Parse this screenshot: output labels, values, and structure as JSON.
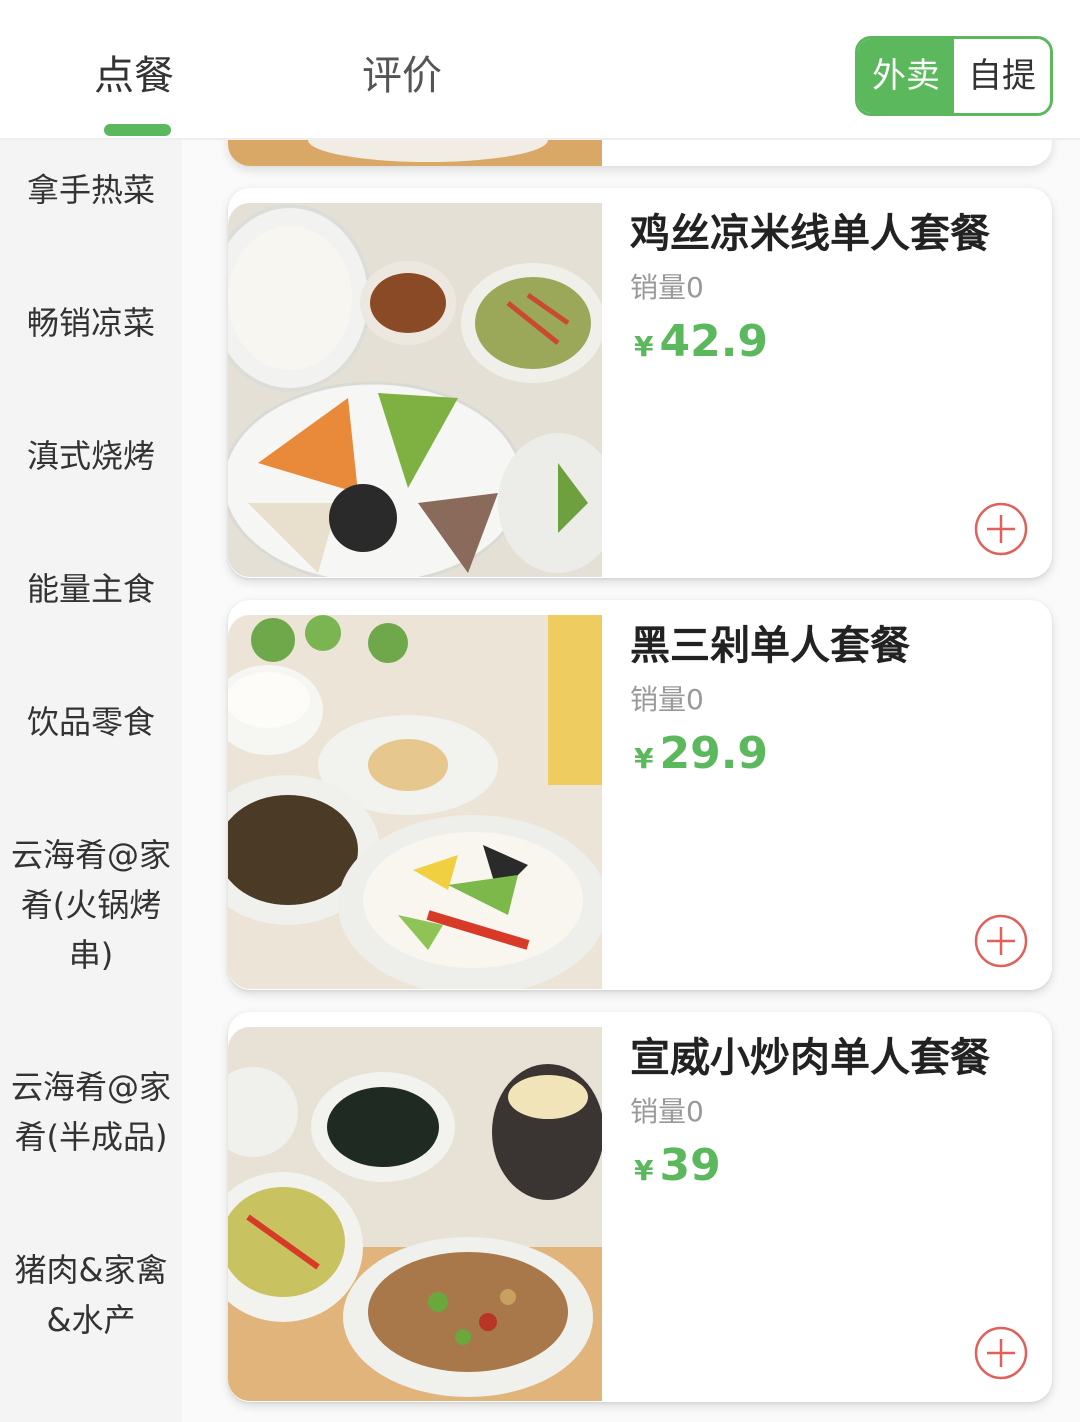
{
  "header": {
    "tabs": [
      {
        "label": "点餐",
        "active": true
      },
      {
        "label": "评价",
        "active": false
      }
    ],
    "mode_switch": {
      "options": [
        "外卖",
        "自提"
      ],
      "selected": "外卖"
    }
  },
  "sidebar": {
    "categories": [
      {
        "label": "拿手热菜"
      },
      {
        "label": "畅销凉菜"
      },
      {
        "label": "滇式烧烤"
      },
      {
        "label": "能量主食"
      },
      {
        "label": "饮品零食"
      },
      {
        "label": "云海肴@家肴(火锅烤串)"
      },
      {
        "label": "云海肴@家肴(半成品)"
      },
      {
        "label": "猪肉&家禽&水产"
      }
    ]
  },
  "menu": {
    "items": [
      {
        "name": "鸡丝凉米线单人套餐",
        "sales": "销量0",
        "currency": "¥",
        "price": "42.9",
        "image": "rice-noodle-set-photo"
      },
      {
        "name": "黑三剁单人套餐",
        "sales": "销量0",
        "currency": "¥",
        "price": "29.9",
        "image": "hei-san-duo-set-photo"
      },
      {
        "name": "宣威小炒肉单人套餐",
        "sales": "销量0",
        "currency": "¥",
        "price": "39",
        "image": "stir-fry-pork-set-photo"
      }
    ]
  },
  "colors": {
    "accent": "#5cb85c",
    "add_icon": "#e0605a",
    "sidebar_bg": "#f4f4f4"
  }
}
